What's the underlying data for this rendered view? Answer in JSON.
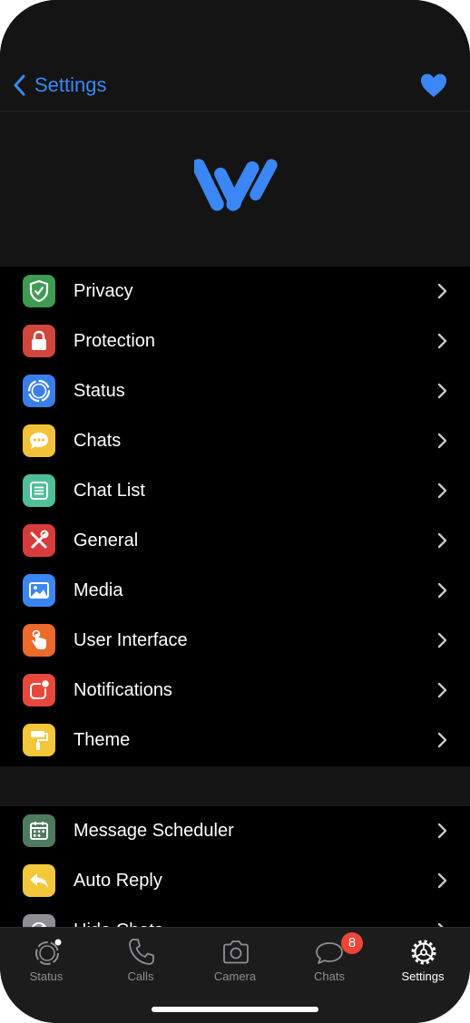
{
  "header": {
    "back_label": "Settings"
  },
  "group1": [
    {
      "label": "Privacy",
      "icon": "shield-icon",
      "color": "#3f9b52"
    },
    {
      "label": "Protection",
      "icon": "lock-icon",
      "color": "#d0463c"
    },
    {
      "label": "Status",
      "icon": "status-ring-icon",
      "color": "#3a7ee8"
    },
    {
      "label": "Chats",
      "icon": "chat-bubble-icon",
      "color": "#f2c23a"
    },
    {
      "label": "Chat List",
      "icon": "list-icon",
      "color": "#4fbf9a"
    },
    {
      "label": "General",
      "icon": "tools-icon",
      "color": "#d83b3b"
    },
    {
      "label": "Media",
      "icon": "photo-icon",
      "color": "#3a86f2"
    },
    {
      "label": "User Interface",
      "icon": "tap-icon",
      "color": "#ec6a2a"
    },
    {
      "label": "Notifications",
      "icon": "notification-icon",
      "color": "#e8483c"
    },
    {
      "label": "Theme",
      "icon": "paint-roller-icon",
      "color": "#f2c83a"
    }
  ],
  "group2": [
    {
      "label": "Message Scheduler",
      "icon": "calendar-icon",
      "color": "#4e7a5e"
    },
    {
      "label": "Auto Reply",
      "icon": "reply-icon",
      "color": "#f2c83a"
    },
    {
      "label": "Hide Chats",
      "icon": "hide-icon",
      "color": "#8e8e93"
    }
  ],
  "tabs": [
    {
      "label": "Status",
      "icon": "status-icon",
      "active": false
    },
    {
      "label": "Calls",
      "icon": "phone-icon",
      "active": false
    },
    {
      "label": "Camera",
      "icon": "camera-icon",
      "active": false
    },
    {
      "label": "Chats",
      "icon": "chats-icon",
      "active": false
    },
    {
      "label": "Settings",
      "icon": "settings-icon",
      "active": true
    }
  ],
  "chats_badge": "8"
}
